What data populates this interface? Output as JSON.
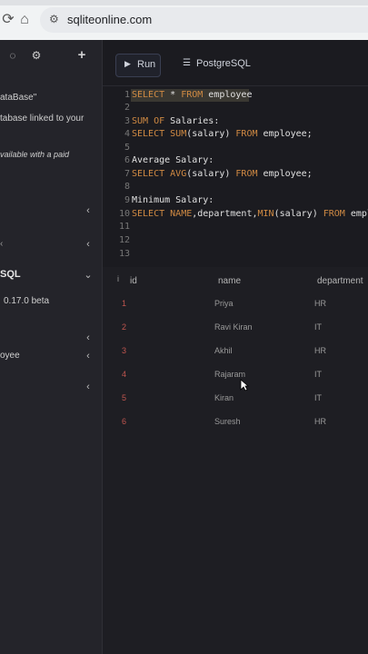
{
  "browser": {
    "url": "sqliteonline.com",
    "icons": [
      "refresh-icon",
      "home-icon",
      "site-tune-icon"
    ]
  },
  "sidebar": {
    "top_icons": [
      "chat-icon",
      "gear-icon",
      "plus-icon"
    ],
    "items": [
      {
        "label": "ataBase\""
      },
      {
        "label": "tabase linked to your"
      },
      {
        "label": "vailable with a paid"
      },
      {
        "label": "SQL"
      },
      {
        "label": "0.17.0 beta"
      },
      {
        "label": "oyee"
      }
    ]
  },
  "toolbar": {
    "run_label": "Run",
    "postgres_label": "PostgreSQL"
  },
  "editor": {
    "lines": [
      {
        "n": "1",
        "text": "SELECT * FROM employee"
      },
      {
        "n": "2",
        "text": ""
      },
      {
        "n": "3",
        "text": "SUM OF Salaries:"
      },
      {
        "n": "4",
        "text": "SELECT SUM(salary) FROM employee;"
      },
      {
        "n": "5",
        "text": ""
      },
      {
        "n": "6",
        "text": "Average Salary:"
      },
      {
        "n": "7",
        "text": "SELECT AVG(salary) FROM employee;"
      },
      {
        "n": "8",
        "text": ""
      },
      {
        "n": "9",
        "text": "Minimum Salary:"
      },
      {
        "n": "10",
        "text": "SELECT NAME,department,MIN(salary) FROM emplo"
      },
      {
        "n": "11",
        "text": ""
      },
      {
        "n": "12",
        "text": ""
      },
      {
        "n": "13",
        "text": ""
      }
    ]
  },
  "results": {
    "info_icon_text": "i",
    "headers": {
      "id": "id",
      "name": "name",
      "department": "department"
    },
    "rows": [
      {
        "id": "1",
        "name": "Priya",
        "department": "HR"
      },
      {
        "id": "2",
        "name": "Ravi Kiran",
        "department": "IT"
      },
      {
        "id": "3",
        "name": "Akhil",
        "department": "HR"
      },
      {
        "id": "4",
        "name": "Rajaram",
        "department": "IT"
      },
      {
        "id": "5",
        "name": "Kiran",
        "department": "IT"
      },
      {
        "id": "6",
        "name": "Suresh",
        "department": "HR"
      }
    ]
  }
}
